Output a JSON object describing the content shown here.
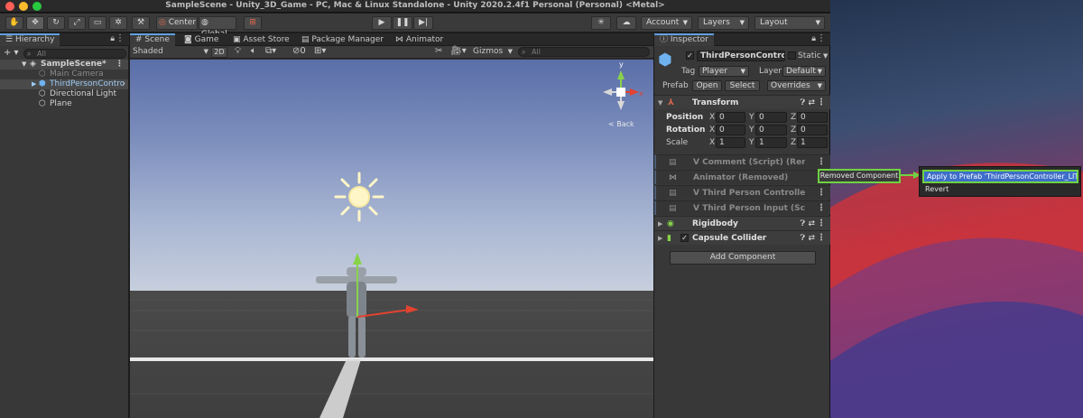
{
  "window": {
    "title": "SampleScene - Unity_3D_Game - PC, Mac & Linux Standalone - Unity 2020.2.4f1 Personal (Personal) <Metal>",
    "traffic_colors": [
      "#fe5f57",
      "#febc2e",
      "#28c840"
    ]
  },
  "toolbar": {
    "tools": [
      "hand-icon",
      "move-icon",
      "rotate-icon",
      "scale-icon",
      "rect-icon",
      "transform-icon",
      "custom-tool-icon"
    ],
    "pivot_label": "Center",
    "space_label": "Global",
    "play_icons": [
      "play-icon",
      "pause-icon",
      "step-icon"
    ],
    "account_label": "Account",
    "layers_label": "Layers",
    "layout_label": "Layout"
  },
  "hierarchy": {
    "tab_label": "Hierarchy",
    "search_placeholder": "All",
    "scene_name": "SampleScene*",
    "items": [
      {
        "label": "Main Camera"
      },
      {
        "label": "ThirdPersonContro"
      },
      {
        "label": "Directional Light"
      },
      {
        "label": "Plane"
      }
    ]
  },
  "scene_view": {
    "tabs": [
      "Scene",
      "Game",
      "Asset Store",
      "Package Manager",
      "Animator"
    ],
    "shading_label": "Shaded",
    "mode_2d_label": "2D",
    "fx_count": "0",
    "gizmos_label": "Gizmos",
    "search_placeholder": "All",
    "gizmo_axes": {
      "y": "y",
      "x": "x"
    },
    "back_label": "< Back",
    "colors": {
      "sky_top": "#5a6ea8",
      "ground": "#434343",
      "x_axis": "#e2432f",
      "y_axis": "#88d34a"
    }
  },
  "inspector": {
    "tab_label": "Inspector",
    "object_name": "ThirdPersonController_",
    "static_label": "Static",
    "tag_label": "Tag",
    "tag_value": "Player",
    "layer_label": "Layer",
    "layer_value": "Default",
    "prefab_label": "Prefab",
    "open_label": "Open",
    "select_label": "Select",
    "overrides_label": "Overrides",
    "transform": {
      "title": "Transform",
      "rows": [
        {
          "label": "Position",
          "x": "0",
          "y": "0",
          "z": "0"
        },
        {
          "label": "Rotation",
          "x": "0",
          "y": "0",
          "z": "0"
        },
        {
          "label": "Scale",
          "x": "1",
          "y": "1",
          "z": "1"
        }
      ],
      "axis_labels": [
        "X",
        "Y",
        "Z"
      ]
    },
    "removed_components": [
      "V Comment (Script) (Remove",
      "Animator (Removed)",
      "V Third Person Controller (Sc",
      "V Third Person Input (Script)"
    ],
    "rigidbody_label": "Rigidbody",
    "capsule_label": "Capsule Collider",
    "add_component_label": "Add Component"
  },
  "context": {
    "removed_component_label": "Removed Component",
    "apply_label": "Apply to Prefab 'ThirdPersonController_LITE'",
    "revert_label": "Revert",
    "highlight_color": "#6fd244"
  }
}
